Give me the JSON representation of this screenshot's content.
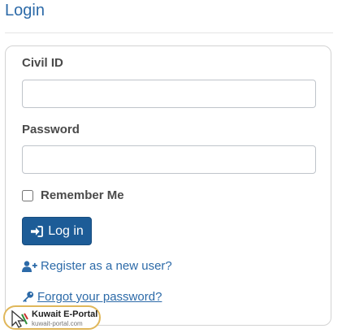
{
  "page": {
    "title": "Login"
  },
  "form": {
    "civil_id": {
      "label": "Civil ID",
      "value": "",
      "placeholder": ""
    },
    "password": {
      "label": "Password",
      "value": "",
      "placeholder": ""
    },
    "remember_me": {
      "label": "Remember Me",
      "checked": false
    },
    "login_button": {
      "label": "Log in",
      "icon": "sign-in-icon"
    }
  },
  "links": {
    "register": {
      "label": "Register as a new user?",
      "icon": "user-plus-icon"
    },
    "forgot_password": {
      "label": "Forgot your password?",
      "icon": "key-icon"
    }
  },
  "watermark": {
    "title": "Kuwait E-Portal",
    "subtitle": "kuwait-portal.com"
  },
  "colors": {
    "accent": "#2c6aa8",
    "button": "#1d5c97",
    "watermark_border": "#e0b75a"
  }
}
